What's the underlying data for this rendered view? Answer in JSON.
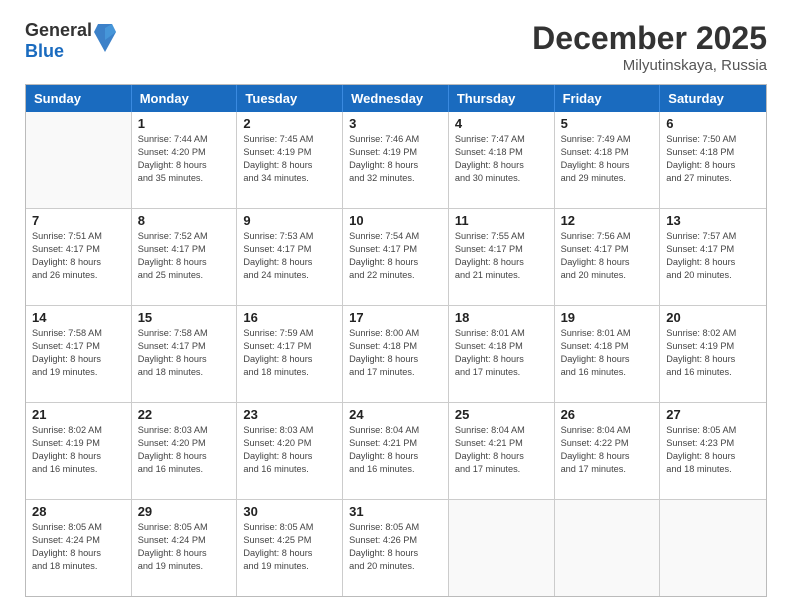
{
  "logo": {
    "general": "General",
    "blue": "Blue"
  },
  "title": "December 2025",
  "location": "Milyutinskaya, Russia",
  "weekdays": [
    "Sunday",
    "Monday",
    "Tuesday",
    "Wednesday",
    "Thursday",
    "Friday",
    "Saturday"
  ],
  "weeks": [
    [
      {
        "day": "",
        "info": ""
      },
      {
        "day": "1",
        "info": "Sunrise: 7:44 AM\nSunset: 4:20 PM\nDaylight: 8 hours\nand 35 minutes."
      },
      {
        "day": "2",
        "info": "Sunrise: 7:45 AM\nSunset: 4:19 PM\nDaylight: 8 hours\nand 34 minutes."
      },
      {
        "day": "3",
        "info": "Sunrise: 7:46 AM\nSunset: 4:19 PM\nDaylight: 8 hours\nand 32 minutes."
      },
      {
        "day": "4",
        "info": "Sunrise: 7:47 AM\nSunset: 4:18 PM\nDaylight: 8 hours\nand 30 minutes."
      },
      {
        "day": "5",
        "info": "Sunrise: 7:49 AM\nSunset: 4:18 PM\nDaylight: 8 hours\nand 29 minutes."
      },
      {
        "day": "6",
        "info": "Sunrise: 7:50 AM\nSunset: 4:18 PM\nDaylight: 8 hours\nand 27 minutes."
      }
    ],
    [
      {
        "day": "7",
        "info": "Sunrise: 7:51 AM\nSunset: 4:17 PM\nDaylight: 8 hours\nand 26 minutes."
      },
      {
        "day": "8",
        "info": "Sunrise: 7:52 AM\nSunset: 4:17 PM\nDaylight: 8 hours\nand 25 minutes."
      },
      {
        "day": "9",
        "info": "Sunrise: 7:53 AM\nSunset: 4:17 PM\nDaylight: 8 hours\nand 24 minutes."
      },
      {
        "day": "10",
        "info": "Sunrise: 7:54 AM\nSunset: 4:17 PM\nDaylight: 8 hours\nand 22 minutes."
      },
      {
        "day": "11",
        "info": "Sunrise: 7:55 AM\nSunset: 4:17 PM\nDaylight: 8 hours\nand 21 minutes."
      },
      {
        "day": "12",
        "info": "Sunrise: 7:56 AM\nSunset: 4:17 PM\nDaylight: 8 hours\nand 20 minutes."
      },
      {
        "day": "13",
        "info": "Sunrise: 7:57 AM\nSunset: 4:17 PM\nDaylight: 8 hours\nand 20 minutes."
      }
    ],
    [
      {
        "day": "14",
        "info": "Sunrise: 7:58 AM\nSunset: 4:17 PM\nDaylight: 8 hours\nand 19 minutes."
      },
      {
        "day": "15",
        "info": "Sunrise: 7:58 AM\nSunset: 4:17 PM\nDaylight: 8 hours\nand 18 minutes."
      },
      {
        "day": "16",
        "info": "Sunrise: 7:59 AM\nSunset: 4:17 PM\nDaylight: 8 hours\nand 18 minutes."
      },
      {
        "day": "17",
        "info": "Sunrise: 8:00 AM\nSunset: 4:18 PM\nDaylight: 8 hours\nand 17 minutes."
      },
      {
        "day": "18",
        "info": "Sunrise: 8:01 AM\nSunset: 4:18 PM\nDaylight: 8 hours\nand 17 minutes."
      },
      {
        "day": "19",
        "info": "Sunrise: 8:01 AM\nSunset: 4:18 PM\nDaylight: 8 hours\nand 16 minutes."
      },
      {
        "day": "20",
        "info": "Sunrise: 8:02 AM\nSunset: 4:19 PM\nDaylight: 8 hours\nand 16 minutes."
      }
    ],
    [
      {
        "day": "21",
        "info": "Sunrise: 8:02 AM\nSunset: 4:19 PM\nDaylight: 8 hours\nand 16 minutes."
      },
      {
        "day": "22",
        "info": "Sunrise: 8:03 AM\nSunset: 4:20 PM\nDaylight: 8 hours\nand 16 minutes."
      },
      {
        "day": "23",
        "info": "Sunrise: 8:03 AM\nSunset: 4:20 PM\nDaylight: 8 hours\nand 16 minutes."
      },
      {
        "day": "24",
        "info": "Sunrise: 8:04 AM\nSunset: 4:21 PM\nDaylight: 8 hours\nand 16 minutes."
      },
      {
        "day": "25",
        "info": "Sunrise: 8:04 AM\nSunset: 4:21 PM\nDaylight: 8 hours\nand 17 minutes."
      },
      {
        "day": "26",
        "info": "Sunrise: 8:04 AM\nSunset: 4:22 PM\nDaylight: 8 hours\nand 17 minutes."
      },
      {
        "day": "27",
        "info": "Sunrise: 8:05 AM\nSunset: 4:23 PM\nDaylight: 8 hours\nand 18 minutes."
      }
    ],
    [
      {
        "day": "28",
        "info": "Sunrise: 8:05 AM\nSunset: 4:24 PM\nDaylight: 8 hours\nand 18 minutes."
      },
      {
        "day": "29",
        "info": "Sunrise: 8:05 AM\nSunset: 4:24 PM\nDaylight: 8 hours\nand 19 minutes."
      },
      {
        "day": "30",
        "info": "Sunrise: 8:05 AM\nSunset: 4:25 PM\nDaylight: 8 hours\nand 19 minutes."
      },
      {
        "day": "31",
        "info": "Sunrise: 8:05 AM\nSunset: 4:26 PM\nDaylight: 8 hours\nand 20 minutes."
      },
      {
        "day": "",
        "info": ""
      },
      {
        "day": "",
        "info": ""
      },
      {
        "day": "",
        "info": ""
      }
    ]
  ]
}
